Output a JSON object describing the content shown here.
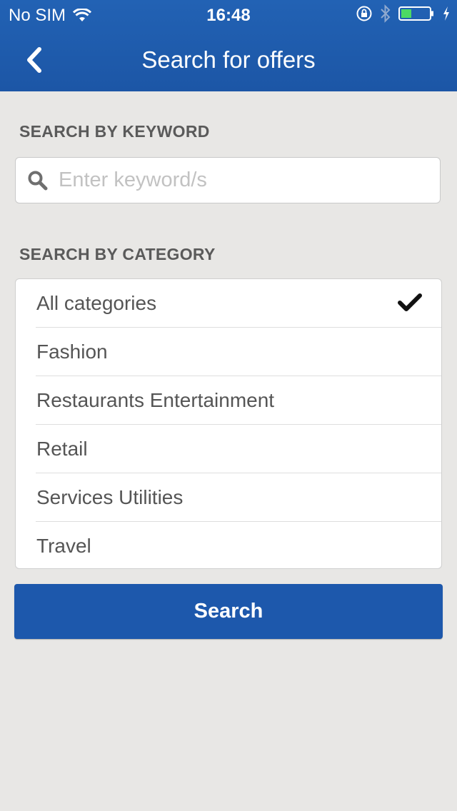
{
  "status_bar": {
    "carrier": "No SIM",
    "time": "16:48",
    "battery_color": "#4cd964"
  },
  "nav": {
    "title": "Search for offers",
    "back_icon": "chevron-left-icon"
  },
  "keyword_section": {
    "label": "SEARCH BY KEYWORD",
    "placeholder": "Enter keyword/s",
    "value": ""
  },
  "category_section": {
    "label": "SEARCH BY CATEGORY",
    "selected": "All categories",
    "items": [
      {
        "label": "All categories",
        "selected": true
      },
      {
        "label": "Fashion",
        "selected": false
      },
      {
        "label": "Restaurants Entertainment",
        "selected": false
      },
      {
        "label": "Retail",
        "selected": false
      },
      {
        "label": "Services Utilities",
        "selected": false
      },
      {
        "label": "Travel",
        "selected": false
      }
    ]
  },
  "search_button": {
    "label": "Search"
  },
  "colors": {
    "header": "#1d5aab",
    "background": "#e8e7e5",
    "button": "#1d58ac"
  }
}
